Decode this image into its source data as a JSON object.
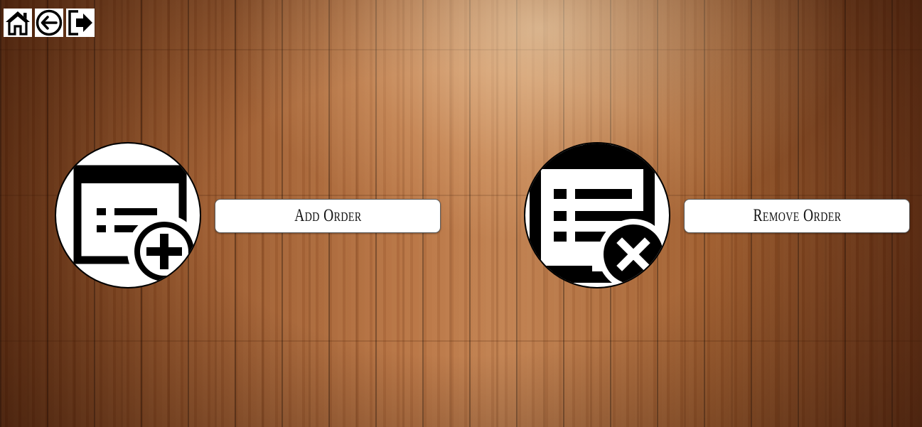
{
  "nav": {
    "home_icon": "home-icon",
    "back_icon": "arrow-left-circle-icon",
    "logout_icon": "sign-out-icon"
  },
  "actions": {
    "add": {
      "label": "Add Order",
      "icon": "order-add-icon"
    },
    "remove": {
      "label": "Remove Order",
      "icon": "order-remove-icon"
    }
  },
  "colors": {
    "icon_fg": "#000000",
    "icon_bg": "#ffffff",
    "background": "#9b5a2c"
  }
}
